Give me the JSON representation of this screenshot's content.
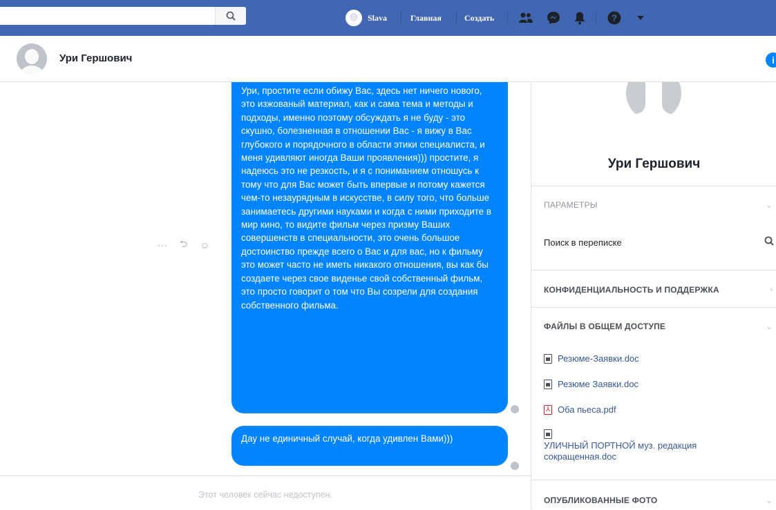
{
  "topbar": {
    "search_placeholder": "",
    "user_name": "Slava",
    "home_label": "Главная",
    "create_label": "Создать"
  },
  "conversation": {
    "contact_name": "Ури Гершович",
    "info_icon": "i",
    "messages": [
      "Ури, простите если обижу Вас, здесь нет ничего нового, это изжованый материал, как и сама тема и методы и подходы, именно поэтому обсуждать я не буду - это скушно, болезненная в отношении Вас - я вижу в Вас глубокого и  порядочного в области этики специалиста, и меня удивляют иногда Ваши проявления))) простите, я надеюсь это не резкость, и я с пониманием отношусь к тому что для Вас может быть впервые и потому кажется чем-то незаурядным в искусстве, в силу того, что больше занимаетесь другими науками и когда с ними приходите в мир кино, то видите фильм через призму Ваших совершенств в специальности, это очень большое достоинство прежде всего о Вас и для вас, но к фильму это может часто не иметь никакого отношения, вы как бы создаете через свое виденье свой собственный фильм, это просто говорит о том что Вы созрели для создания собственного фильма.",
      "Дау не единичный случай, когда удивлен Вами)))"
    ],
    "actions": {
      "more": "···",
      "reply": "⮌",
      "react": "☺"
    },
    "compose_status": "Этот человек сейчас недоступен."
  },
  "panel": {
    "name": "Ури Гершович",
    "options_title": "Параметры",
    "search_in_conversation": "Поиск в переписке",
    "privacy_title": "Конфиденциальность и поддержка",
    "shared_files_title": "Файлы в общем доступе",
    "files": [
      {
        "name": "Резюме-Заявки.doc",
        "type": "doc"
      },
      {
        "name": "Резюме Заявки.doc",
        "type": "doc"
      },
      {
        "name": "Оба пьеса.pdf",
        "type": "pdf"
      }
    ],
    "file_multi_line1": "УЛИЧНЫЙ ПОРТНОЙ муз. редакция",
    "file_multi_line2": "сокращенная.doc",
    "shared_photos_title": "Опубликованные фото"
  },
  "colors": {
    "topbar": "#4267b2",
    "bubble": "#0084ff",
    "link": "#365899",
    "muted": "#90949c"
  }
}
